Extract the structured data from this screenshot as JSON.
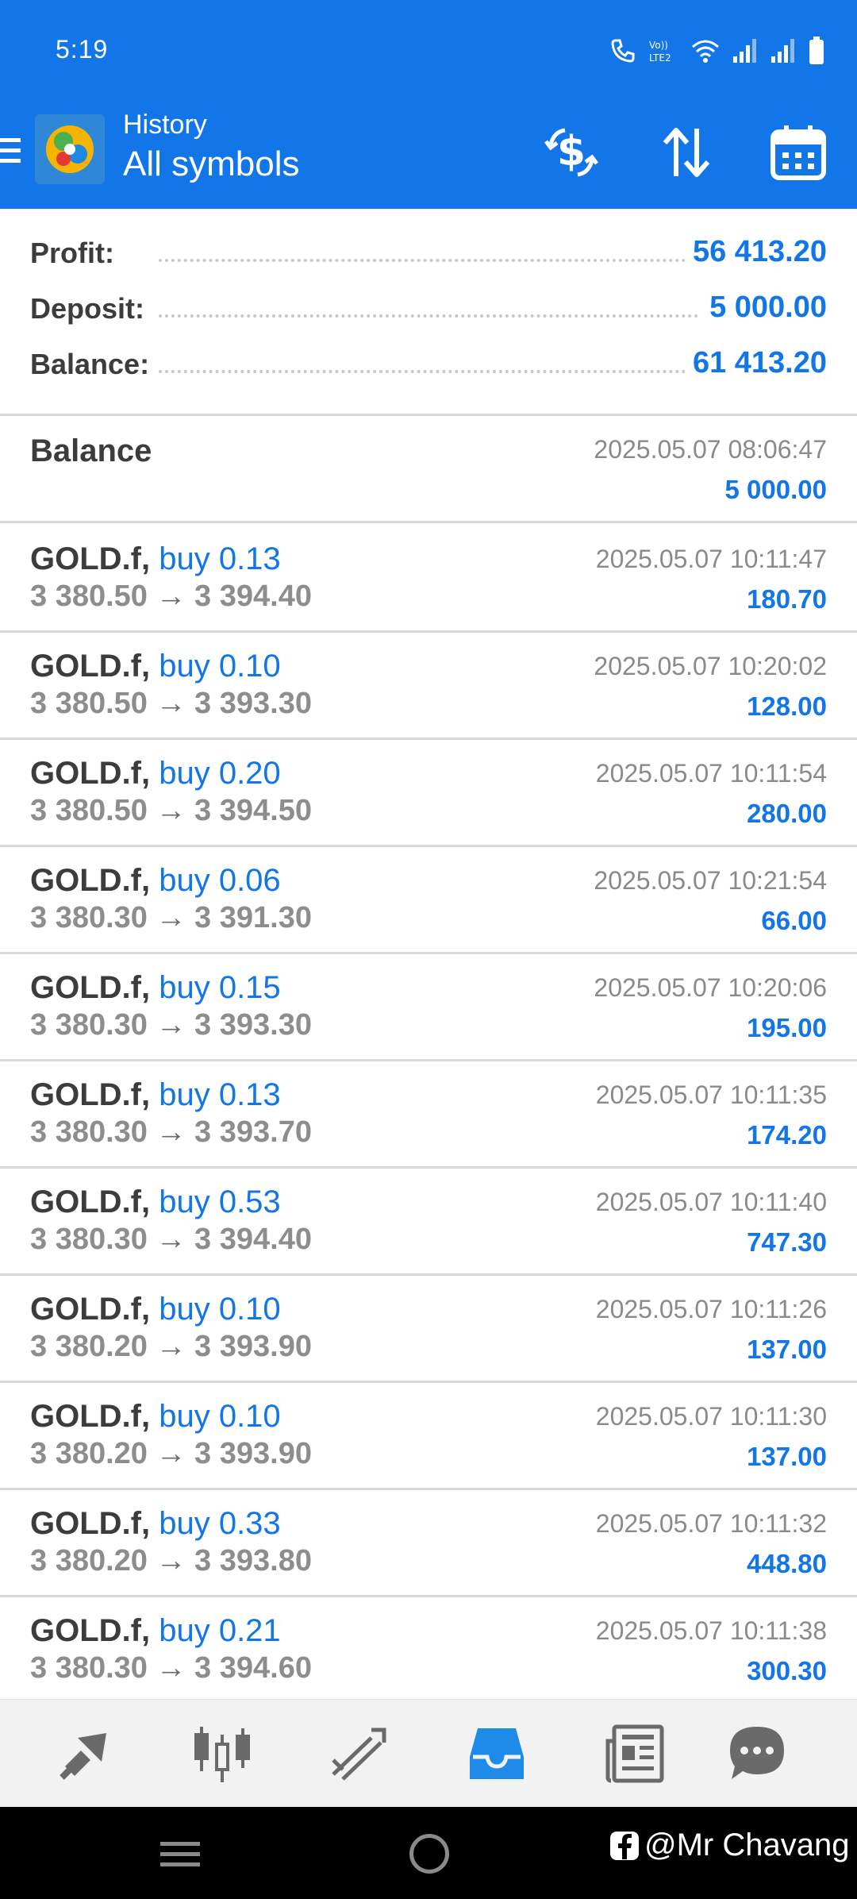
{
  "status_bar": {
    "time": "5:19"
  },
  "header": {
    "title_small": "History",
    "title_big": "All symbols"
  },
  "summary": [
    {
      "label": "Profit:",
      "value": "56 413.20"
    },
    {
      "label": "Deposit:",
      "value": "5 000.00"
    },
    {
      "label": "Balance:",
      "value": "61 413.20"
    }
  ],
  "balance_entry": {
    "title": "Balance",
    "time": "2025.05.07 08:06:47",
    "amount": "5 000.00"
  },
  "deals": [
    {
      "symbol": "GOLD.f,",
      "side": "buy 0.13",
      "open": "3 380.50",
      "arrow": "→",
      "close": "3 394.40",
      "time": "2025.05.07 10:11:47",
      "profit": "180.70"
    },
    {
      "symbol": "GOLD.f,",
      "side": "buy 0.10",
      "open": "3 380.50",
      "arrow": "→",
      "close": "3 393.30",
      "time": "2025.05.07 10:20:02",
      "profit": "128.00"
    },
    {
      "symbol": "GOLD.f,",
      "side": "buy 0.20",
      "open": "3 380.50",
      "arrow": "→",
      "close": "3 394.50",
      "time": "2025.05.07 10:11:54",
      "profit": "280.00"
    },
    {
      "symbol": "GOLD.f,",
      "side": "buy 0.06",
      "open": "3 380.30",
      "arrow": "→",
      "close": "3 391.30",
      "time": "2025.05.07 10:21:54",
      "profit": "66.00"
    },
    {
      "symbol": "GOLD.f,",
      "side": "buy 0.15",
      "open": "3 380.30",
      "arrow": "→",
      "close": "3 393.30",
      "time": "2025.05.07 10:20:06",
      "profit": "195.00"
    },
    {
      "symbol": "GOLD.f,",
      "side": "buy 0.13",
      "open": "3 380.30",
      "arrow": "→",
      "close": "3 393.70",
      "time": "2025.05.07 10:11:35",
      "profit": "174.20"
    },
    {
      "symbol": "GOLD.f,",
      "side": "buy 0.53",
      "open": "3 380.30",
      "arrow": "→",
      "close": "3 394.40",
      "time": "2025.05.07 10:11:40",
      "profit": "747.30"
    },
    {
      "symbol": "GOLD.f,",
      "side": "buy 0.10",
      "open": "3 380.20",
      "arrow": "→",
      "close": "3 393.90",
      "time": "2025.05.07 10:11:26",
      "profit": "137.00"
    },
    {
      "symbol": "GOLD.f,",
      "side": "buy 0.10",
      "open": "3 380.20",
      "arrow": "→",
      "close": "3 393.90",
      "time": "2025.05.07 10:11:30",
      "profit": "137.00"
    },
    {
      "symbol": "GOLD.f,",
      "side": "buy 0.33",
      "open": "3 380.20",
      "arrow": "→",
      "close": "3 393.80",
      "time": "2025.05.07 10:11:32",
      "profit": "448.80"
    },
    {
      "symbol": "GOLD.f,",
      "side": "buy 0.21",
      "open": "3 380.30",
      "arrow": "→",
      "close": "3 394.60",
      "time": "2025.05.07 10:11:38",
      "profit": "300.30"
    }
  ],
  "bottom_nav": [
    {
      "icon": "quotes-icon"
    },
    {
      "icon": "chart-icon"
    },
    {
      "icon": "trade-icon"
    },
    {
      "icon": "history-icon",
      "active": true
    },
    {
      "icon": "news-icon"
    },
    {
      "icon": "chat-icon"
    }
  ],
  "watermark": {
    "text": "@Mr Chavang"
  },
  "colors": {
    "accent": "#1275e8",
    "header_bg": "#1275e8",
    "text_dark": "#3c3c3c",
    "text_grey": "#8d8d8d"
  }
}
